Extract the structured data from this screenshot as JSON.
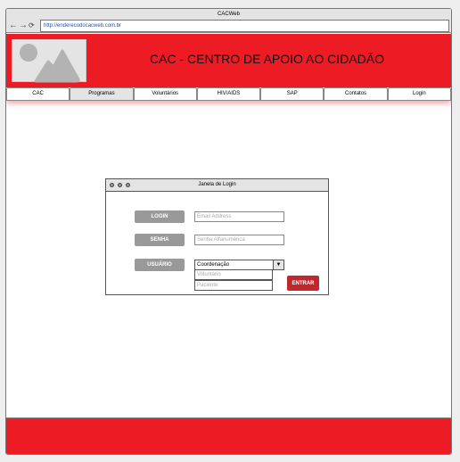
{
  "browser": {
    "title": "CACWeb",
    "url": "http://enderecodocacweb.com.br"
  },
  "header": {
    "title": "CAC - CENTRO DE APOIO AO CIDADÃO"
  },
  "nav": {
    "items": [
      "CAC",
      "Programas",
      "Voluntários",
      "HIV/AIDS",
      "SAP",
      "Contatos",
      "Login"
    ]
  },
  "dialog": {
    "title": "Janela de Login",
    "login_label": "LOGIN",
    "login_placeholder": "Email Address",
    "senha_label": "SENHA",
    "senha_placeholder": "Senha Alfanumérica",
    "usuario_label": "USUÁRIO",
    "usuario_selected": "Coordenação",
    "usuario_options": [
      "Voluntário",
      "Paciente"
    ],
    "submit": "ENTRAR"
  },
  "colors": {
    "brand": "#ed1c24",
    "button": "#c1272d"
  }
}
